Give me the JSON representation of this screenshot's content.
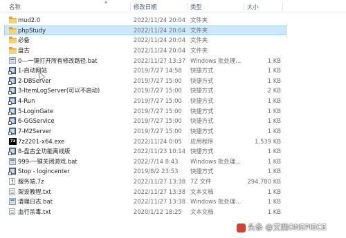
{
  "header": {
    "name": "名称",
    "date": "修改日期",
    "type": "类型",
    "size": "大小"
  },
  "files": [
    {
      "name": "mud2.0",
      "date": "2022/11/24 20:04",
      "type": "文件夹",
      "size": "",
      "icon": "folder-icon",
      "selected": false
    },
    {
      "name": "phpStudy",
      "date": "2022/11/24 20:04",
      "type": "文件夹",
      "size": "",
      "icon": "folder-icon",
      "selected": true
    },
    {
      "name": "必备",
      "date": "2022/11/24 20:04",
      "type": "文件夹",
      "size": "",
      "icon": "folder-icon",
      "selected": false
    },
    {
      "name": "盘古",
      "date": "2022/11/24 20:04",
      "type": "文件夹",
      "size": "",
      "icon": "folder-icon",
      "selected": false
    },
    {
      "name": "0---一键打开所有修改路径.bat",
      "date": "2022/11/27 13:37",
      "type": "Windows 批处理...",
      "size": "1 KB",
      "icon": "batch-file-icon",
      "selected": false
    },
    {
      "name": "1-启动网站",
      "date": "2019/7/27 14:58",
      "type": "快捷方式",
      "size": "1 KB",
      "icon": "shortcut-icon",
      "selected": false
    },
    {
      "name": "2-DBServer",
      "date": "2019/7/27 15:00",
      "type": "快捷方式",
      "size": "1 KB",
      "icon": "shortcut-icon",
      "selected": false
    },
    {
      "name": "3-ItemLogServer(可以不启动)",
      "date": "2019/7/27 15:00",
      "type": "快捷方式",
      "size": "2 KB",
      "icon": "shortcut-icon",
      "selected": false
    },
    {
      "name": "4-Run",
      "date": "2019/7/27 15:00",
      "type": "快捷方式",
      "size": "1 KB",
      "icon": "shortcut-icon",
      "selected": false
    },
    {
      "name": "5-LoginGate",
      "date": "2019/7/27 15:00",
      "type": "快捷方式",
      "size": "1 KB",
      "icon": "shortcut-icon",
      "selected": false
    },
    {
      "name": "6-GGService",
      "date": "2019/7/27 15:00",
      "type": "快捷方式",
      "size": "1 KB",
      "icon": "shortcut-icon",
      "selected": false
    },
    {
      "name": "7-M2Server",
      "date": "2019/7/27 15:00",
      "type": "快捷方式",
      "size": "1 KB",
      "icon": "shortcut-icon",
      "selected": false
    },
    {
      "name": "7z2201-x64.exe",
      "date": "2022/11/24 0:05",
      "type": "应用程序",
      "size": "1,539 KB",
      "icon": "7zip-installer-icon",
      "selected": false
    },
    {
      "name": "8-盘古全功能离线版",
      "date": "2022/11/23 10:14",
      "type": "快捷方式",
      "size": "1 KB",
      "icon": "shortcut-icon",
      "selected": false
    },
    {
      "name": "999-一键关闭游戏.bat",
      "date": "2022/7/14 8:43",
      "type": "Windows 批处理...",
      "size": "1 KB",
      "icon": "batch-file-icon",
      "selected": false
    },
    {
      "name": "Stop - logincenter",
      "date": "2019/8/2 23:53",
      "type": "快捷方式",
      "size": "1 KB",
      "icon": "stop-shortcut-icon",
      "selected": false
    },
    {
      "name": "服务端.7z",
      "date": "2022/11/27 13:38",
      "type": "7Z 文件",
      "size": "294,780 KB",
      "icon": "archive-icon",
      "selected": false
    },
    {
      "name": "架设教程.txt",
      "date": "2022/11/27 13:38",
      "type": "文本文档",
      "size": "1 KB",
      "icon": "text-file-icon",
      "selected": false
    },
    {
      "name": "清理日志.bat",
      "date": "2022/11/27 13:38",
      "type": "Windows 批处理...",
      "size": "1 KB",
      "icon": "batch-file-icon",
      "selected": false
    },
    {
      "name": "血行杀毒.txt",
      "date": "2020/1/12 18:25",
      "type": "文本文档",
      "size": "1 KB",
      "icon": "text-file-icon",
      "selected": false
    }
  ],
  "watermark": {
    "text": "头条 @艾西ONEPIECE"
  }
}
